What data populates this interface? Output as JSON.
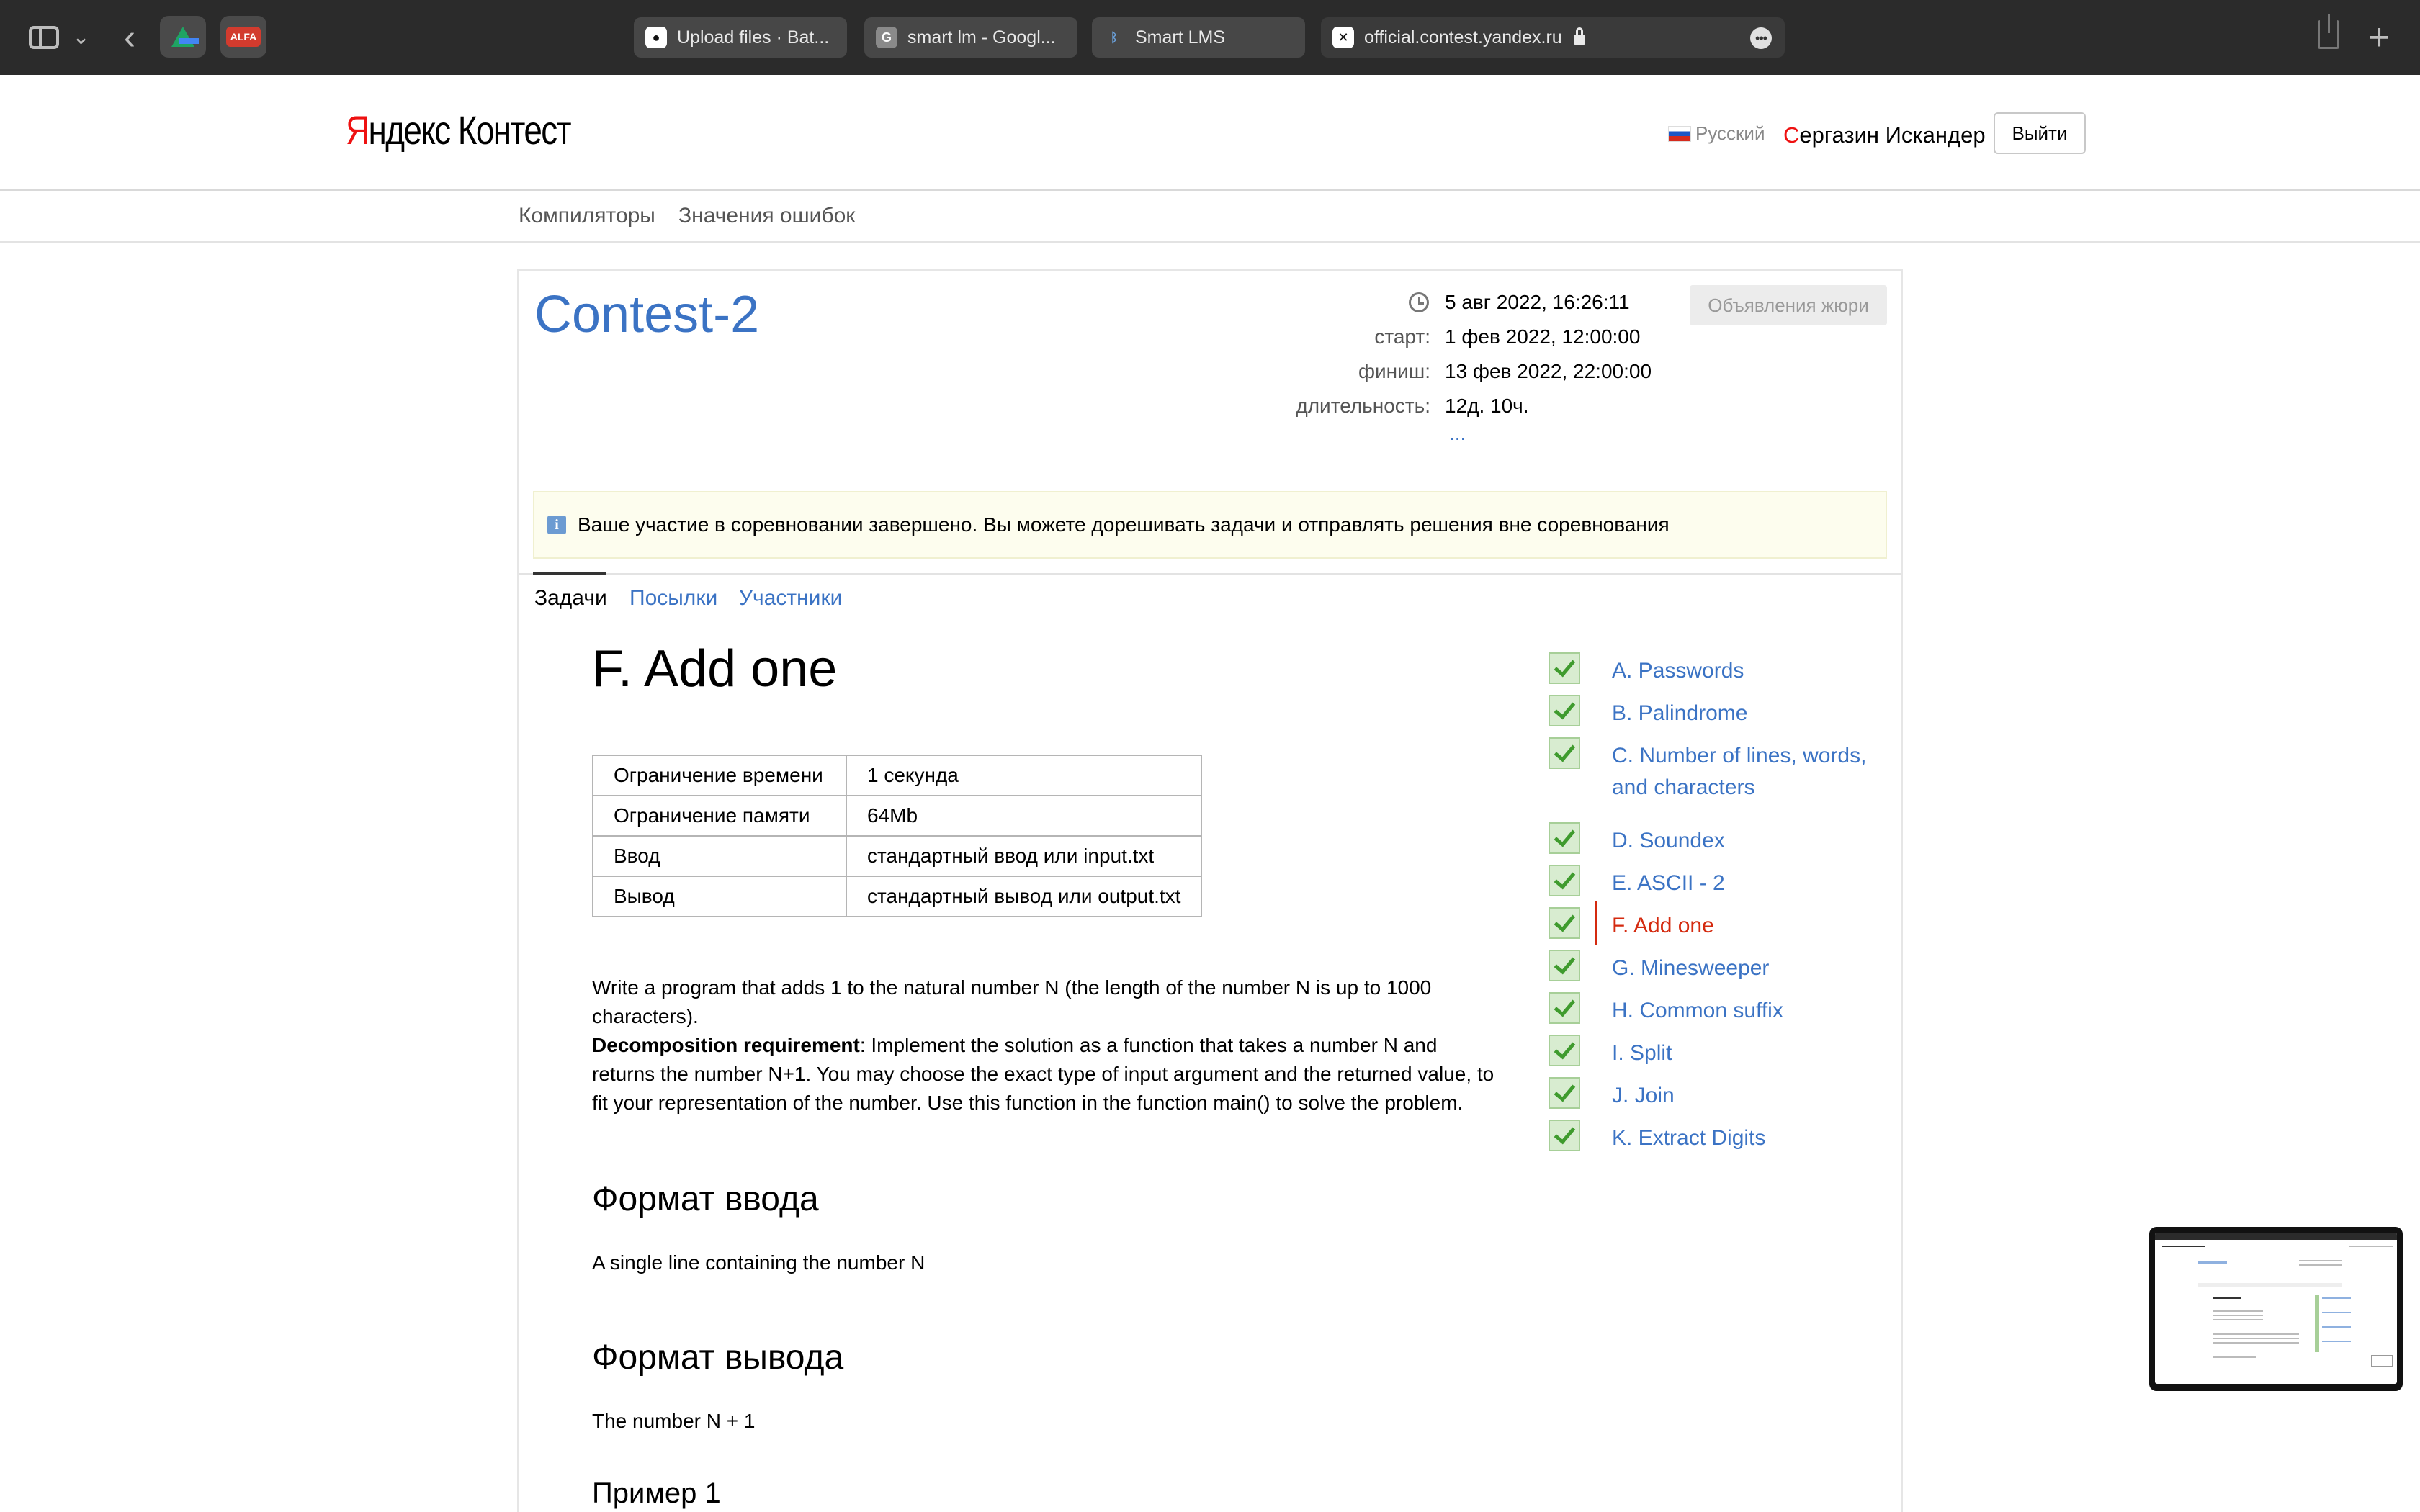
{
  "browser": {
    "tabs": [
      {
        "label": "Upload files · Bat...",
        "favicon": "github-icon"
      },
      {
        "label": "smart lm - Googl...",
        "favicon": "google-docs-icon",
        "fav_text": "G"
      },
      {
        "label": "Smart LMS",
        "favicon": "lms-icon",
        "fav_text": "ᛒ"
      },
      {
        "label": "official.contest.yandex.ru",
        "favicon": "close-icon",
        "fav_text": "✕"
      }
    ],
    "extensions": {
      "alfa": "ALFA"
    }
  },
  "header": {
    "logo_ya": "Я",
    "logo_rest": "ндекс",
    "logo_product": "Контест",
    "language": "Русский",
    "user_first": "С",
    "user_rest": "ергазин Искандер",
    "logout": "Выйти"
  },
  "subnav": {
    "compilers": "Компиляторы",
    "errors": "Значения ошибок"
  },
  "contest": {
    "title": "Contest-2",
    "now": "5 авг 2022, 16:26:11",
    "start_label": "старт:",
    "start": "1 фев 2022, 12:00:00",
    "finish_label": "финиш:",
    "finish": "13 фев 2022, 22:00:00",
    "duration_label": "длительность:",
    "duration": "12д. 10ч.",
    "more": "...",
    "jury_button": "Объявления жюри",
    "notice": "Ваше участие в соревновании завершено. Вы можете дорешивать задачи и отправлять решения вне соревнования",
    "info_glyph": "i"
  },
  "tabs": {
    "tasks": "Задачи",
    "submissions": "Посылки",
    "participants": "Участники"
  },
  "problem": {
    "title": "F. Add one",
    "limits": [
      {
        "key": "Ограничение времени",
        "value": "1 секунда"
      },
      {
        "key": "Ограничение памяти",
        "value": "64Mb"
      },
      {
        "key": "Ввод",
        "value": "стандартный ввод или input.txt"
      },
      {
        "key": "Вывод",
        "value": "стандартный вывод или output.txt"
      }
    ],
    "statement_p1": "Write a program that adds 1 to the natural number N (the length of the number N is up to 1000 characters).",
    "decomp_label": "Decomposition requirement",
    "statement_p2": ": Implement the solution as a function that takes a number N and returns the number N+1. You may choose the exact type of input argument and the returned value, to fit your representation of the number. Use this function in the function main() to solve the problem.",
    "input_heading": "Формат ввода",
    "input_text": "A single line containing the number N",
    "output_heading": "Формат вывода",
    "output_text": "The number N + 1",
    "example_heading": "Пример 1"
  },
  "problem_list": [
    {
      "label": "A. Passwords",
      "solved": true
    },
    {
      "label": "B. Palindrome",
      "solved": true
    },
    {
      "label": "C. Number of lines, words, and characters",
      "solved": true
    },
    {
      "label": "D. Soundex",
      "solved": true
    },
    {
      "label": "E. ASCII - 2",
      "solved": true
    },
    {
      "label": "F. Add one",
      "solved": true,
      "current": true
    },
    {
      "label": "G. Minesweeper",
      "solved": true
    },
    {
      "label": "H. Common suffix",
      "solved": true
    },
    {
      "label": "I. Split",
      "solved": true
    },
    {
      "label": "J. Join",
      "solved": true
    },
    {
      "label": "K. Extract Digits",
      "solved": true
    }
  ],
  "colors": {
    "link": "#3b73c4",
    "current": "#d42a0f",
    "solved_bg": "#d8ecd0",
    "notice_bg": "#fdfdee"
  }
}
